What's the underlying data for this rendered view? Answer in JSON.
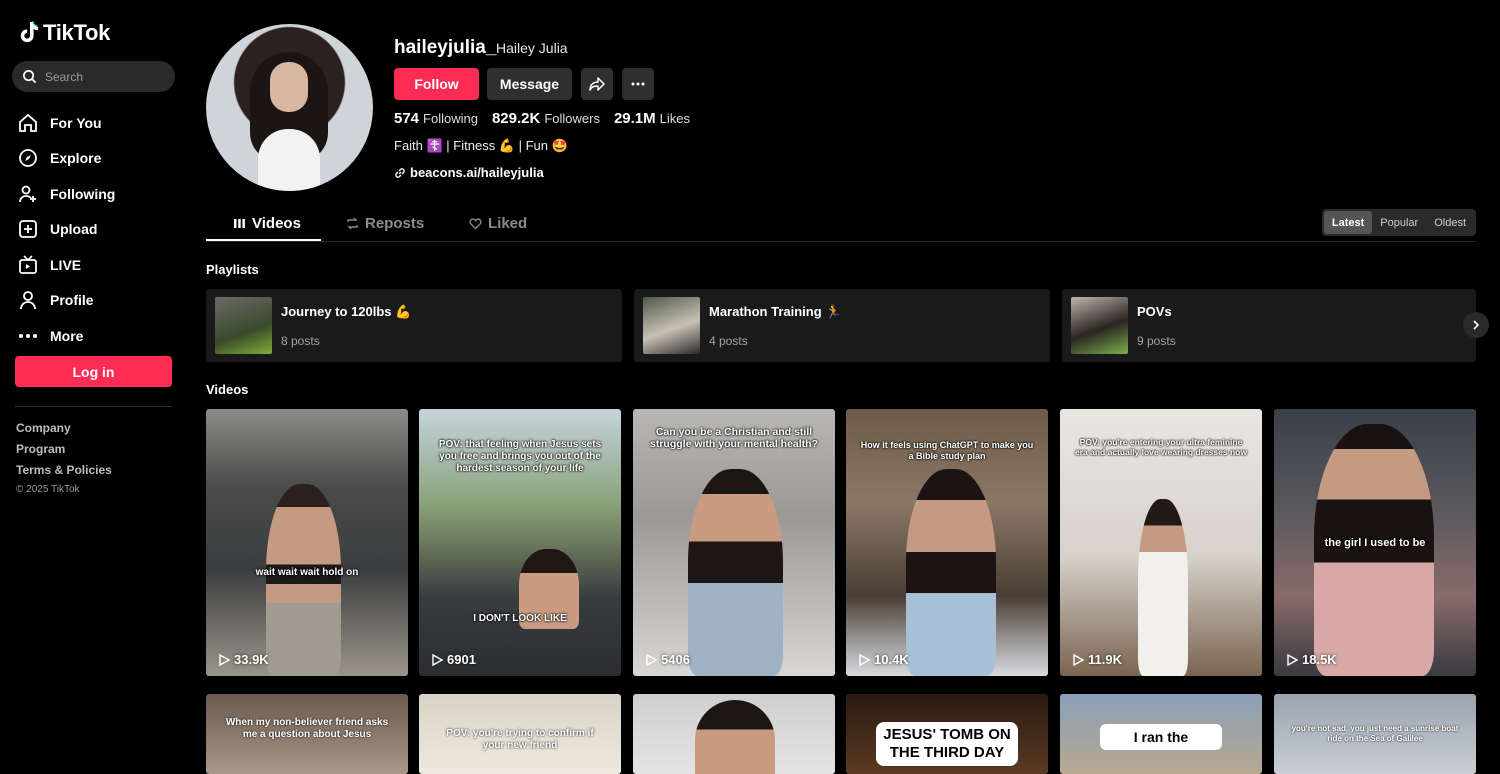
{
  "app": {
    "name": "TikTok"
  },
  "search": {
    "placeholder": "Search"
  },
  "nav": [
    {
      "label": "For You",
      "icon": "home-icon"
    },
    {
      "label": "Explore",
      "icon": "compass-icon"
    },
    {
      "label": "Following",
      "icon": "user-plus-icon"
    },
    {
      "label": "Upload",
      "icon": "plus-square-icon"
    },
    {
      "label": "LIVE",
      "icon": "tv-icon"
    },
    {
      "label": "Profile",
      "icon": "person-icon"
    },
    {
      "label": "More",
      "icon": "more-dots-icon"
    }
  ],
  "login_label": "Log in",
  "footer": {
    "company": "Company",
    "program": "Program",
    "terms": "Terms & Policies",
    "copyright": "© 2025 TikTok"
  },
  "profile": {
    "username": "haileyjulia_",
    "display_name": "Hailey Julia",
    "follow_label": "Follow",
    "message_label": "Message",
    "following_count": "574",
    "following_label": "Following",
    "followers_count": "829.2K",
    "followers_label": "Followers",
    "likes_count": "29.1M",
    "likes_label": "Likes",
    "bio": "Faith ☦️ | Fitness 💪 | Fun 🤩",
    "link": "beacons.ai/haileyjulia"
  },
  "tabs": [
    {
      "label": "Videos"
    },
    {
      "label": "Reposts"
    },
    {
      "label": "Liked"
    }
  ],
  "sort": [
    "Latest",
    "Popular",
    "Oldest"
  ],
  "playlists_label": "Playlists",
  "playlists": [
    {
      "title": "Journey to 120lbs 💪",
      "posts": "8 posts"
    },
    {
      "title": "Marathon Training 🏃",
      "posts": "4 posts"
    },
    {
      "title": "POVs",
      "posts": "9 posts"
    }
  ],
  "videos_label": "Videos",
  "videos": [
    {
      "caption": "wait wait wait hold on",
      "views": "33.9K"
    },
    {
      "caption": "POV: that feeling when Jesus sets you free and brings you out of the hardest season of your life",
      "caption2": "I DON'T LOOK LIKE",
      "views": "6901"
    },
    {
      "caption": "Can you be a Christian and still struggle with your mental health?",
      "views": "5406"
    },
    {
      "caption": "How it feels using ChatGPT to make you a Bible study plan",
      "views": "10.4K"
    },
    {
      "caption": "POV: you're entering your ultra feminine era and actually love wearing dresses now",
      "views": "11.9K"
    },
    {
      "caption": "the girl I used to be",
      "views": "18.5K"
    }
  ],
  "videos_row2": [
    {
      "caption": "When my non-believer friend asks me a question about Jesus"
    },
    {
      "caption": "POV: you're trying to confirm if your new friend"
    },
    {
      "caption": ""
    },
    {
      "caption": "JESUS' TOMB ON THE THIRD DAY"
    },
    {
      "caption": "I ran the"
    },
    {
      "caption": "you're not sad, you just need a sunrise boat ride on the Sea of Galilee"
    }
  ]
}
